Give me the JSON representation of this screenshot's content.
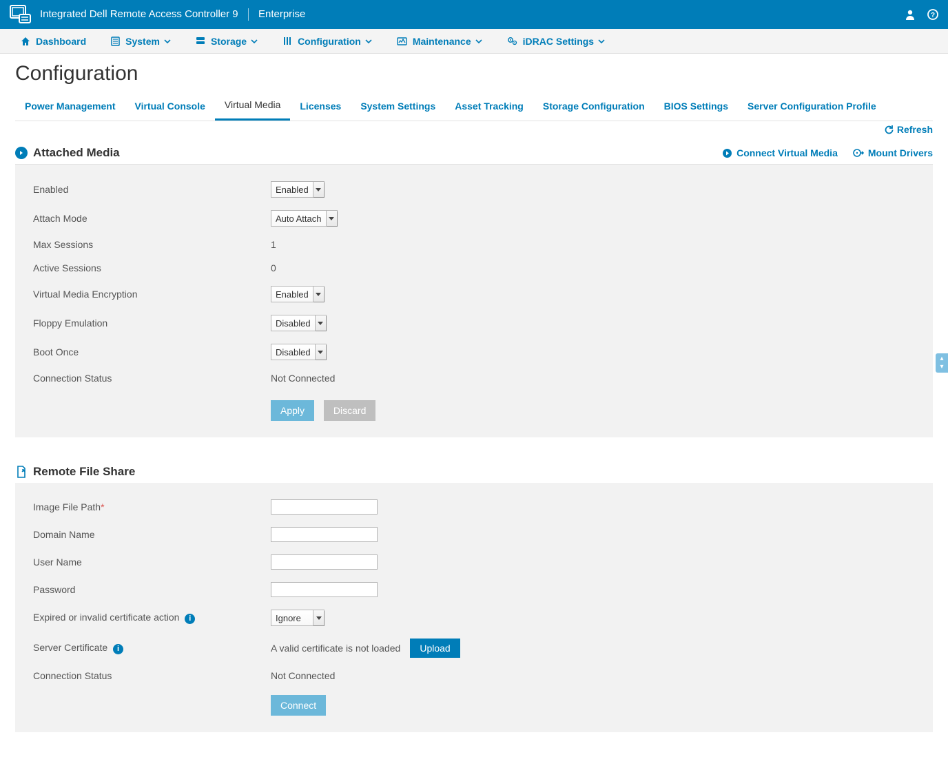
{
  "banner": {
    "title_main": "Integrated Dell Remote Access Controller 9",
    "title_suffix": "Enterprise"
  },
  "topnav": {
    "dashboard": "Dashboard",
    "system": "System",
    "storage": "Storage",
    "configuration": "Configuration",
    "maintenance": "Maintenance",
    "idrac": "iDRAC Settings"
  },
  "page": {
    "title": "Configuration",
    "refresh": "Refresh"
  },
  "tabs": {
    "power": "Power Management",
    "vconsole": "Virtual Console",
    "vmedia": "Virtual Media",
    "licenses": "Licenses",
    "sys_settings": "System Settings",
    "asset": "Asset Tracking",
    "storage_cfg": "Storage Configuration",
    "bios": "BIOS Settings",
    "scp": "Server Configuration Profile"
  },
  "attached_media": {
    "section_title": "Attached Media",
    "connect_action": "Connect Virtual Media",
    "mount_action": "Mount Drivers",
    "labels": {
      "enabled": "Enabled",
      "attach_mode": "Attach Mode",
      "max_sessions": "Max Sessions",
      "active_sessions": "Active Sessions",
      "vm_encryption": "Virtual Media Encryption",
      "floppy": "Floppy Emulation",
      "boot_once": "Boot Once",
      "conn_status": "Connection Status"
    },
    "values": {
      "enabled": "Enabled",
      "attach_mode": "Auto Attach",
      "max_sessions": "1",
      "active_sessions": "0",
      "vm_encryption": "Enabled",
      "floppy": "Disabled",
      "boot_once": "Disabled",
      "conn_status": "Not Connected"
    },
    "buttons": {
      "apply": "Apply",
      "discard": "Discard"
    }
  },
  "rfs": {
    "section_title": "Remote File Share",
    "labels": {
      "image_path": "Image File Path",
      "domain": "Domain Name",
      "user": "User Name",
      "password": "Password",
      "cert_action": "Expired or invalid certificate action",
      "server_cert": "Server Certificate",
      "conn_status": "Connection Status"
    },
    "values": {
      "image_path": "",
      "domain": "",
      "user": "",
      "password": "",
      "cert_action": "Ignore",
      "server_cert_msg": "A valid certificate is not loaded",
      "conn_status": "Not Connected"
    },
    "buttons": {
      "upload": "Upload",
      "connect": "Connect"
    }
  }
}
